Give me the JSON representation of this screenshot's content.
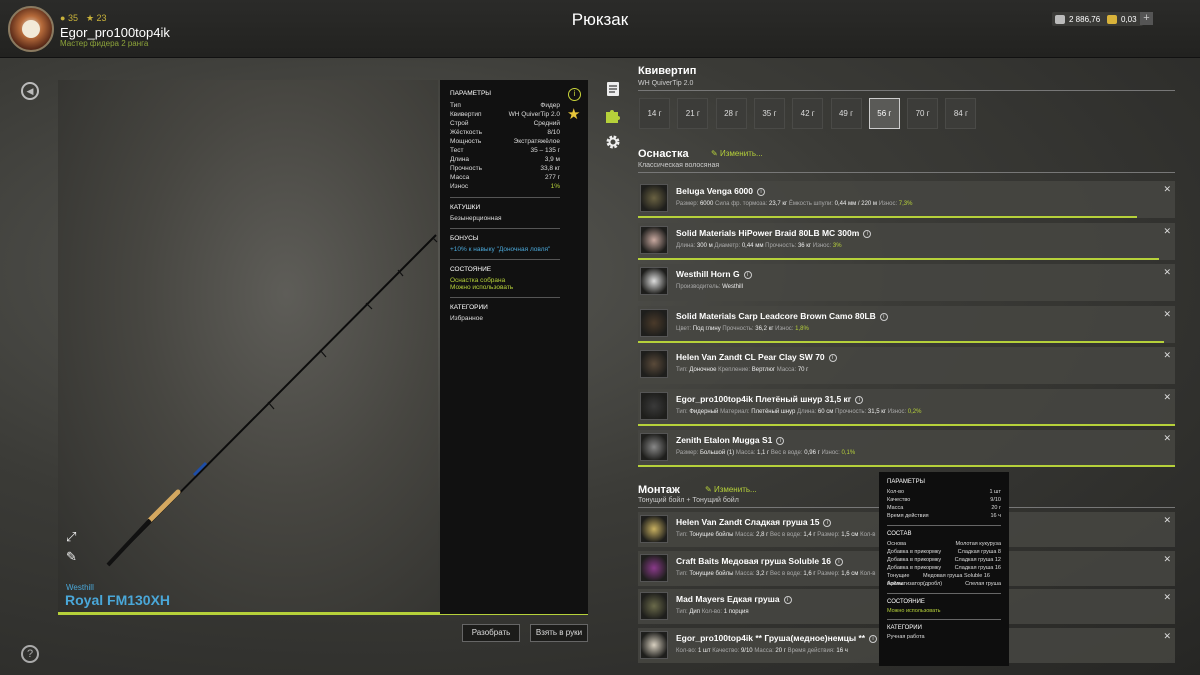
{
  "header": {
    "stat_coins": "35",
    "stat_stars": "23",
    "username": "Egor_pro100top4ik",
    "rank": "Мастер фидера 2 ранга",
    "page_title": "Рюкзак",
    "silver": "2 886,76",
    "gold": "0,03",
    "plus": "+"
  },
  "rod": {
    "brand": "Westhill",
    "name": "Royal FM130XH"
  },
  "params": {
    "title": "Параметры",
    "rows": [
      {
        "k": "Тип",
        "v": "Фидер"
      },
      {
        "k": "Квивертип",
        "v": "WH QuiverTip 2.0"
      },
      {
        "k": "Строй",
        "v": "Средний"
      },
      {
        "k": "Жёсткость",
        "v": "8/10"
      },
      {
        "k": "Мощность",
        "v": "Экстратяжёлое"
      },
      {
        "k": "Тест",
        "v": "35 – 135 г"
      },
      {
        "k": "Длина",
        "v": "3,9 м"
      },
      {
        "k": "Прочность",
        "v": "33,8 кг"
      },
      {
        "k": "Масса",
        "v": "277 г"
      },
      {
        "k": "Износ",
        "v": "1%"
      }
    ],
    "reels_title": "Катушки",
    "reels_value": "Безынерционная",
    "bonus_title": "Бонусы",
    "bonus_value": "+10% к навыку \"Доночная ловля\"",
    "state_title": "Состояние",
    "state_1": "Оснастка собрана",
    "state_2": "Можно использовать",
    "cat_title": "Категории",
    "cat_value": "Избранное"
  },
  "buttons": {
    "disassemble": "Разобрать",
    "take": "Взять в руки"
  },
  "quiver": {
    "title": "Квивертип",
    "subtitle": "WH QuiverTip 2.0",
    "weights": [
      "14 г",
      "21 г",
      "28 г",
      "35 г",
      "42 г",
      "49 г",
      "56 г",
      "70 г",
      "84 г"
    ],
    "selected": "56 г"
  },
  "tackle": {
    "title": "Оснастка",
    "edit": "Изменить...",
    "subtitle": "Классическая волосяная",
    "items": [
      {
        "name": "Beluga Venga 6000",
        "desc": [
          [
            "Размер:",
            "6000"
          ],
          [
            "Сила фр. тормоза:",
            "23,7 кг"
          ],
          [
            "Ёмкость шпули:",
            "0,44 мм / 220 м"
          ],
          [
            "Износ:",
            "7,3%"
          ]
        ],
        "bar": 0.93
      },
      {
        "name": "Solid Materials HiPower Braid 80LB MC 300m",
        "desc": [
          [
            "Длина:",
            "300 м"
          ],
          [
            "Диаметр:",
            "0,44 мм"
          ],
          [
            "Прочность:",
            "36 кг"
          ],
          [
            "Износ:",
            "3%"
          ]
        ],
        "bar": 0.97
      },
      {
        "name": "Westhill Horn G",
        "desc": [
          [
            "Производитель:",
            "Westhill"
          ]
        ],
        "bar": 0
      },
      {
        "name": "Solid Materials Carp Leadcore Brown Camo 80LB",
        "desc": [
          [
            "Цвет:",
            "Под глину"
          ],
          [
            "Прочность:",
            "36,2 кг"
          ],
          [
            "Износ:",
            "1,8%"
          ]
        ],
        "bar": 0.98
      },
      {
        "name": "Helen Van Zandt CL Pear Clay SW 70",
        "desc": [
          [
            "Тип:",
            "Доночное"
          ],
          [
            "Крепление:",
            "Вертлюг"
          ],
          [
            "Масса:",
            "70 г"
          ]
        ],
        "bar": 0
      },
      {
        "name": "Egor_pro100top4ik Плетёный шнур 31,5 кг",
        "desc": [
          [
            "Тип:",
            "Фидерный"
          ],
          [
            "Материал:",
            "Плетёный шнур"
          ],
          [
            "Длина:",
            "60 см"
          ],
          [
            "Прочность:",
            "31,5 кг"
          ],
          [
            "Износ:",
            "0,2%"
          ]
        ],
        "bar": 1
      },
      {
        "name": "Zenith Etalon Mugga S1",
        "desc": [
          [
            "Размер:",
            "Большой (1)"
          ],
          [
            "Масса:",
            "1,1 г"
          ],
          [
            "Вес в воде:",
            "0,96 г"
          ],
          [
            "Износ:",
            "0,1%"
          ]
        ],
        "bar": 1
      }
    ]
  },
  "montage": {
    "title": "Монтаж",
    "edit": "Изменить...",
    "subtitle": "Тонущий бойл + Тонущий бойл",
    "items": [
      {
        "name": "Helen Van Zandt Сладкая груша 15",
        "desc": [
          [
            "Тип:",
            "Тонущие бойлы"
          ],
          [
            "Масса:",
            "2,8 г"
          ],
          [
            "Вес в воде:",
            "1,4 г"
          ],
          [
            "Размер:",
            "1,5 см"
          ],
          [
            "Кол-в",
            ""
          ]
        ]
      },
      {
        "name": "Craft Baits Медовая груша Soluble 16",
        "desc": [
          [
            "Тип:",
            "Тонущие бойлы"
          ],
          [
            "Масса:",
            "3,2 г"
          ],
          [
            "Вес в воде:",
            "1,6 г"
          ],
          [
            "Размер:",
            "1,6 см"
          ],
          [
            "Кол-в",
            ""
          ]
        ]
      },
      {
        "name": "Mad Mayers Едкая груша",
        "desc": [
          [
            "Тип:",
            "Дип"
          ],
          [
            "Кол-во:",
            "1 порция"
          ]
        ]
      },
      {
        "name": "Egor_pro100top4ik ** Груша(медное)немцы **",
        "desc": [
          [
            "Кол-во:",
            "1 шт"
          ],
          [
            "Качество:",
            "9/10"
          ],
          [
            "Масса:",
            "20 г"
          ],
          [
            "Время действия:",
            "16 ч"
          ]
        ]
      }
    ]
  },
  "tooltip": {
    "title": "Параметры",
    "rows": [
      {
        "k": "Кол-во",
        "v": "1 шт"
      },
      {
        "k": "Качество",
        "v": "9/10"
      },
      {
        "k": "Масса",
        "v": "20 г"
      },
      {
        "k": "Время действия",
        "v": "16 ч"
      }
    ],
    "comp_title": "Состав",
    "comp": [
      {
        "k": "Основа",
        "v": "Молотая кукуруза"
      },
      {
        "k": "Добавка в прикормку",
        "v": "Сладкая груша 8"
      },
      {
        "k": "Добавка в прикормку",
        "v": "Сладкая груша 12"
      },
      {
        "k": "Добавка в прикормку",
        "v": "Сладкая груша 16"
      },
      {
        "k": "Тонущие бойлы",
        "v": "Медовая груша Soluble 16 (дробл)"
      },
      {
        "k": "Ароматизатор",
        "v": "Спелая груша"
      }
    ],
    "state_title": "Состояние",
    "state": "Можно использовать",
    "cat_title": "Категории",
    "cat": "Ручная работа"
  },
  "colors": {
    "accent": "#b6d13a",
    "link": "#4aa7d8"
  },
  "icons": [
    "back-icon",
    "help-icon",
    "info-icon",
    "star-icon",
    "expand-icon",
    "brush-icon",
    "notes-icon",
    "puzzle-icon",
    "gear-icon",
    "close-icon",
    "edit-icon"
  ]
}
